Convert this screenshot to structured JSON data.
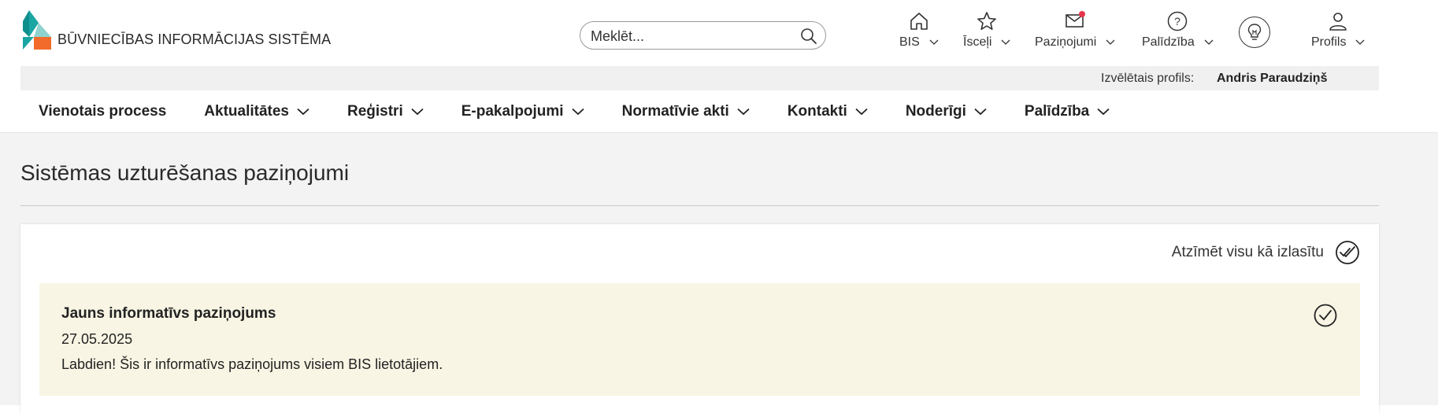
{
  "header": {
    "logo_text": "BŪVNIECĪBAS INFORMĀCIJAS SISTĒMA",
    "search_placeholder": "Meklēt...",
    "nav": {
      "bis_label": "BIS",
      "isceli_label": "Īsceļi",
      "pazinojumi_label": "Paziņojumi",
      "palidziba_label": "Palīdzība",
      "profils_label": "Profils"
    }
  },
  "profile_bar": {
    "label": "Izvēlētais profils:",
    "name": "Andris Paraudziņš"
  },
  "menu": {
    "items": [
      {
        "label": "Vienotais process"
      },
      {
        "label": "Aktualitātes"
      },
      {
        "label": "Reģistri"
      },
      {
        "label": "E-pakalpojumi"
      },
      {
        "label": "Normatīvie akti"
      },
      {
        "label": "Kontakti"
      },
      {
        "label": "Noderīgi"
      },
      {
        "label": "Palīdzība"
      }
    ]
  },
  "page": {
    "title": "Sistēmas uzturēšanas paziņojumi",
    "mark_all_label": "Atzīmēt visu kā izlasītu"
  },
  "notification": {
    "title": "Jauns informatīvs paziņojums",
    "date": "27.05.2025",
    "body": "Labdien! Šis ir informatīvs paziņojums visiem BIS lietotājiem."
  },
  "colors": {
    "logo_teal": "#1aa6a3",
    "logo_orange": "#f26b2a",
    "notification_dot": "#e8344a",
    "notice_bg": "#f8f5e4",
    "profile_bar_bg": "#f0f0f0",
    "page_bg": "#f3f3f3"
  }
}
